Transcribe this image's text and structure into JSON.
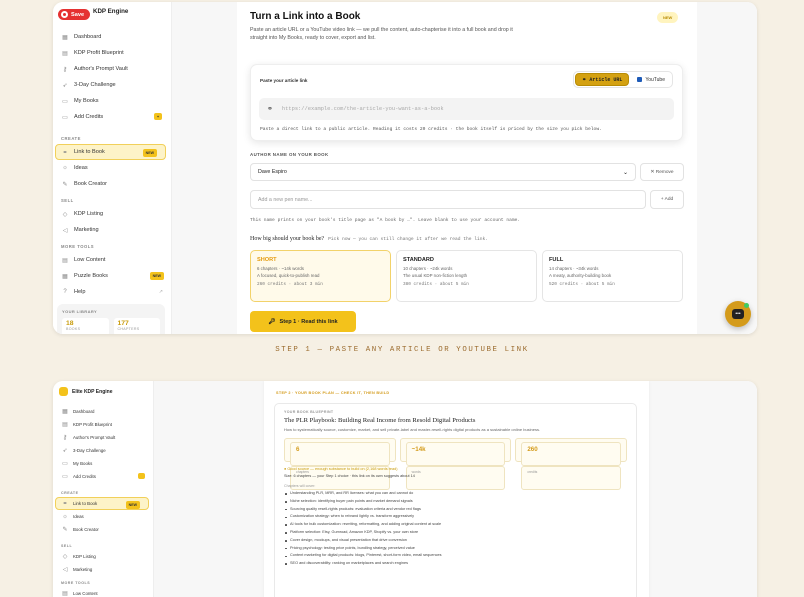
{
  "screenshot1": {
    "rec_button": "Save",
    "brand": "KDP Engine",
    "nav": [
      {
        "label": "Dashboard",
        "icon": "grid-icon"
      },
      {
        "label": "KDP Profit Blueprint",
        "icon": "doc-icon"
      },
      {
        "label": "Author's Prompt Vault",
        "icon": "key-icon"
      },
      {
        "label": "3-Day Challenge",
        "icon": "rocket-icon"
      },
      {
        "label": "My Books",
        "icon": "book-icon"
      },
      {
        "label": "Add Credits",
        "icon": "card-icon",
        "badge": "+"
      }
    ],
    "create_section": "CREATE",
    "create_items": [
      {
        "label": "Link to Book",
        "badge": "NEW"
      },
      {
        "label": "Ideas"
      },
      {
        "label": "Book Creator"
      }
    ],
    "sell_section": "SELL",
    "sell_items": [
      {
        "label": "KDP Listing"
      },
      {
        "label": "Marketing"
      }
    ],
    "tools_section": "MORE TOOLS",
    "tools_items": [
      {
        "label": "Low Content"
      },
      {
        "label": "Puzzle Books",
        "badge": "NEW"
      },
      {
        "label": "Help"
      }
    ],
    "library": {
      "title": "YOUR LIBRARY",
      "books": "18",
      "books_label": "BOOKS",
      "chapters": "177",
      "chapters_label": "CHAPTERS"
    },
    "title": "Turn a Link into a Book",
    "description": "Paste an article URL or a YouTube video link — we pull the content, auto-chapterise it into a full book and drop it straight into My Books, ready to cover, export and list.",
    "new_pill": "NEW",
    "card": {
      "label": "Paste your article link",
      "tab_article": "Article URL",
      "tab_youtube": "YouTube",
      "placeholder": "https://example.com/the-article-you-want-as-a-book",
      "note": "Paste a direct link to a public article. Reading it costs 20 credits · the book itself is priced by the size you pick below."
    },
    "author_heading": "AUTHOR NAME ON YOUR BOOK",
    "author_value": "Dave Espiro",
    "remove": "✕ Remove",
    "pen_placeholder": "Add a new pen name...",
    "add": "+ Add",
    "pen_hint": "This name prints on your book's title page as \"A book by …\". Leave blank to use your account name.",
    "how_big": "How big should your book be?",
    "how_big_hint": "Pick now — you can still change it after we read the link.",
    "sizes": [
      {
        "name": "SHORT",
        "l1": "6 chapters · ~14k words",
        "l2": "A focused, quick-to-publish read",
        "cost": "260 credits · about 3 min",
        "selected": true
      },
      {
        "name": "STANDARD",
        "l1": "10 chapters · ~24k words",
        "l2": "The usual KDP non-fiction length",
        "cost": "380 credits · about 5 min",
        "selected": false
      },
      {
        "name": "FULL",
        "l1": "14 chapters · ~34k words",
        "l2": "A meaty, authority-building book",
        "cost": "520 credits · about 5 min",
        "selected": false
      }
    ],
    "go_button": "Step 1 · Read this link"
  },
  "caption": "STEP 1 — PASTE ANY ARTICLE OR YOUTUBE LINK",
  "screenshot2": {
    "brand": "Elite KDP Engine",
    "nav": [
      "Dashboard",
      "KDP Profit Blueprint",
      "Author's Prompt Vault",
      "3-Day Challenge",
      "My Books",
      "Add Credits"
    ],
    "create_section": "CREATE",
    "create_items": [
      "Link to Book",
      "Ideas",
      "Book Creator"
    ],
    "link_badge": "NEW",
    "sell_section": "SELL",
    "sell_items": [
      "KDP Listing",
      "Marketing"
    ],
    "tools_section": "MORE TOOLS",
    "tools_items": [
      "Low Content"
    ],
    "step": "STEP 2 · YOUR BOOK PLAN — CHECK IT, THEN BUILD",
    "bp_kicker": "YOUR BOOK BLUEPRINT",
    "bp_title": "The PLR Playbook: Building Real Income from Resold Digital Products",
    "bp_sub": "How to systematically source, customize, market, and sell private-label and master-resell-rights digital products as a sustainable online business.",
    "stats": [
      {
        "v": "6",
        "u": "chapters"
      },
      {
        "v": "~14k",
        "u": "words"
      },
      {
        "v": "260",
        "u": "credits"
      }
    ],
    "good_news": "● Good source — enough substance to build on (2,168 words read)",
    "size_line": "Size: 6 chapters — your Step 1 choice · this link on its own suggests about 14",
    "chapters_label": "Chapters will cover:",
    "bullets": [
      "Understanding PLR, MRR, and RR licenses: what you can and cannot do",
      "Niche selection: identifying buyer pain points and market demand signals",
      "Sourcing quality resell-rights products: evaluation criteria and vendor red flags",
      "Customization strategy: when to rebrand lightly vs. transform aggressively",
      "AI tools for bulk customization: rewriting, reformatting, and adding original content at scale",
      "Platform selection: Etsy, Gumroad, Amazon KDP, Shopify vs. your own store",
      "Cover design, mockups, and visual presentation that drive conversion",
      "Pricing psychology: testing price points, bundling strategy, perceived value",
      "Content marketing for digital products: blogs, Pinterest, short-form video, email sequences",
      "SEO and discoverability: ranking on marketplaces and search engines"
    ]
  }
}
